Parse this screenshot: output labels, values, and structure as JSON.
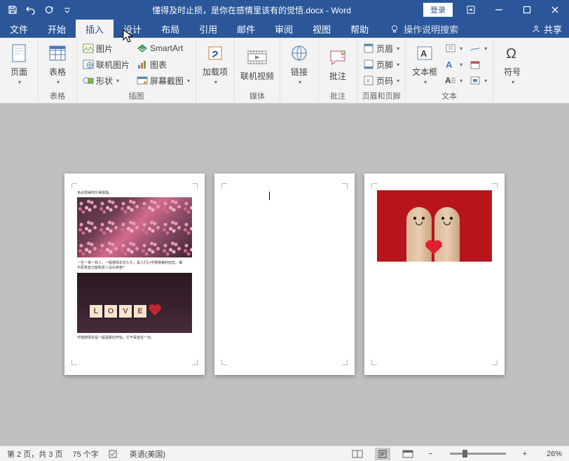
{
  "title": "懂得及时止损，是你在感情里该有的觉悟.docx  -  Word",
  "login": "登录",
  "tabs": {
    "file": "文件",
    "home": "开始",
    "insert": "插入",
    "design": "设计",
    "layout": "布局",
    "references": "引用",
    "mailings": "邮件",
    "review": "审阅",
    "view": "视图",
    "help": "帮助"
  },
  "tell_me": "操作说明搜索",
  "share": "共享",
  "ribbon": {
    "pages": {
      "label": "页面",
      "btn": "页面"
    },
    "tables": {
      "label": "表格",
      "btn": "表格"
    },
    "illustrations": {
      "label": "插图",
      "pictures": "图片",
      "online_pictures": "联机图片",
      "shapes": "形状",
      "smartart": "SmartArt",
      "chart": "图表",
      "screenshot": "屏幕截图"
    },
    "addins": {
      "label": "加载项",
      "btn": "加载项"
    },
    "media": {
      "label": "媒体",
      "btn": "联机视频"
    },
    "links": {
      "label": "",
      "btn": "链接"
    },
    "comments": {
      "label": "批注",
      "btn": "批注"
    },
    "header_footer": {
      "label": "页眉和页脚",
      "header": "页眉",
      "footer": "页脚",
      "page_number": "页码"
    },
    "text": {
      "label": "文本",
      "btn": "文本框"
    },
    "symbols": {
      "label": "符号",
      "btn": "符号"
    }
  },
  "doc": {
    "p1_line1": "未必想得你乐得孤独。",
    "p1_line2": "一生一世一双人，一般感情长长久久，是人们心中憧憬美的初恋。谁",
    "p1_line3": "不愿意自己能和爱人白头到老？",
    "p1_line4": "可惜感情仅是一般温柔的开始，它不保证任一切。",
    "love_tiles": [
      "L",
      "O",
      "V",
      "E"
    ]
  },
  "status": {
    "page": "第 2 页，共 3 页",
    "words": "75 个字",
    "language": "英语(美国)",
    "zoom": "26%"
  }
}
